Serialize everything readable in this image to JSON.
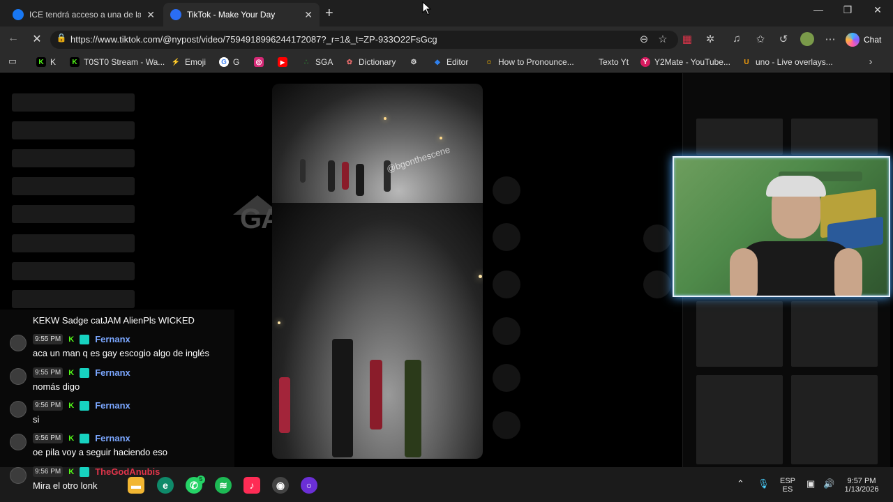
{
  "browser": {
    "tabs": [
      {
        "title": "ICE tendrá acceso a una de las her",
        "favicon_color": "#1877f2",
        "active": false
      },
      {
        "title": "TikTok - Make Your Day",
        "favicon_color": "#2a6df4",
        "active": true
      }
    ],
    "new_tab_icon": "+",
    "window_controls": {
      "minimize": "—",
      "maximize": "❐",
      "close": "✕"
    },
    "url": "https://www.tiktok.com/@nypost/video/7594918996244172087?_r=1&_t=ZP-933O22FsGcg",
    "chat_label": "Chat"
  },
  "bookmarks": [
    {
      "label": "K",
      "icon": "K",
      "color": "#53fc18"
    },
    {
      "label": "T0ST0 Stream - Wa...",
      "icon": "K",
      "color": "#53fc18"
    },
    {
      "label": "Emoji",
      "icon": "⚡",
      "color": "#e11d48"
    },
    {
      "label": "G",
      "icon": "G",
      "color": "#4285f4"
    },
    {
      "label": "",
      "icon": "◎",
      "color": "#d62976"
    },
    {
      "label": "",
      "icon": "▶",
      "color": "#ff0000"
    },
    {
      "label": "SGA",
      "icon": "∴",
      "color": "#2e7d32"
    },
    {
      "label": "Dictionary",
      "icon": "✿",
      "color": "#c0392b"
    },
    {
      "label": "",
      "icon": "⚙",
      "color": "#555555"
    },
    {
      "label": "Editor",
      "icon": "◆",
      "color": "#2f80ed"
    },
    {
      "label": "How to Pronounce...",
      "icon": "☺",
      "color": "#f4b400"
    },
    {
      "label": "Texto Yt",
      "icon": "",
      "color": "#2b2b2b"
    },
    {
      "label": "Y2Mate - YouTube...",
      "icon": "Y",
      "color": "#d81b60"
    },
    {
      "label": "uno - Live overlays...",
      "icon": "U",
      "color": "#f59e0b"
    }
  ],
  "video": {
    "watermark": "@bgonthescene"
  },
  "background_logo": "GAY",
  "chat": {
    "emote_line": "KEKW Sadge catJAM AlienPls WICKED",
    "messages": [
      {
        "time": "9:55 PM",
        "user": "Fernanx",
        "text": "aca un man q es gay escogio algo de inglés"
      },
      {
        "time": "9:55 PM",
        "user": "Fernanx",
        "text": "nomás digo"
      },
      {
        "time": "9:56 PM",
        "user": "Fernanx",
        "text": "si"
      },
      {
        "time": "9:56 PM",
        "user": "Fernanx",
        "text": "oe pila voy a seguir haciendo eso"
      },
      {
        "time": "9:56 PM",
        "user": "TheGodAnubis",
        "text": "Mira el otro lonk"
      }
    ]
  },
  "taskbar": {
    "lang_top": "ESP",
    "lang_bottom": "ES",
    "time": "9:57 PM",
    "date": "1/13/2026",
    "whatsapp_badge": "5"
  }
}
